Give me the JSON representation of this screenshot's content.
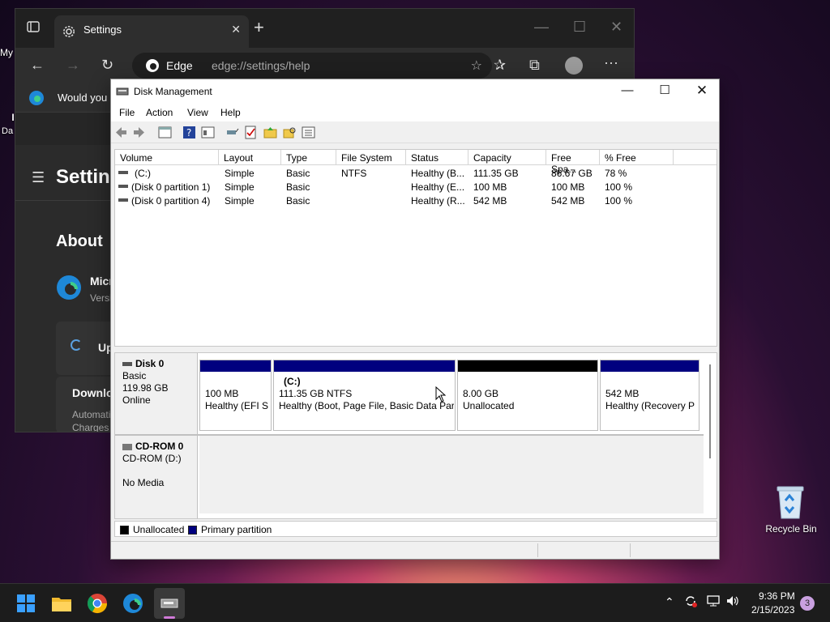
{
  "desktop": {
    "partial_labels": [
      "My",
      "I",
      "Da"
    ],
    "recycle_bin_label": "Recycle Bin"
  },
  "edge": {
    "tab_title": "Settings",
    "site_label": "Edge",
    "url": "edge://settings/help",
    "banner_text": "Would you",
    "page_heading": "Setting",
    "about_heading": "About",
    "product_name": "Micr",
    "version_prefix": "Versi",
    "update_text": "Up",
    "download_text": "Downlo",
    "auto_text": "Automati",
    "charges_text": "Charges"
  },
  "dm": {
    "title": "Disk Management",
    "menu": [
      "File",
      "Action",
      "View",
      "Help"
    ],
    "columns": [
      "Volume",
      "Layout",
      "Type",
      "File System",
      "Status",
      "Capacity",
      "Free Spa...",
      "% Free"
    ],
    "volumes": [
      {
        "volume": "(C:)",
        "layout": "Simple",
        "type": "Basic",
        "fs": "NTFS",
        "status": "Healthy (B...",
        "capacity": "111.35 GB",
        "free": "86.67 GB",
        "pct": "78 %"
      },
      {
        "volume": "(Disk 0 partition 1)",
        "layout": "Simple",
        "type": "Basic",
        "fs": "",
        "status": "Healthy (E...",
        "capacity": "100 MB",
        "free": "100 MB",
        "pct": "100 %"
      },
      {
        "volume": "(Disk 0 partition 4)",
        "layout": "Simple",
        "type": "Basic",
        "fs": "",
        "status": "Healthy (R...",
        "capacity": "542 MB",
        "free": "542 MB",
        "pct": "100 %"
      }
    ],
    "disk0": {
      "name": "Disk 0",
      "type": "Basic",
      "size": "119.98 GB",
      "state": "Online",
      "partitions": [
        {
          "title": "",
          "size": "100 MB",
          "status": "Healthy (EFI Sy",
          "kind": "primary"
        },
        {
          "title": "(C:)",
          "size": "111.35 GB NTFS",
          "status": "Healthy (Boot, Page File, Basic Data Part",
          "kind": "primary"
        },
        {
          "title": "",
          "size": "8.00 GB",
          "status": "Unallocated",
          "kind": "unallocated"
        },
        {
          "title": "",
          "size": "542 MB",
          "status": "Healthy (Recovery Pa",
          "kind": "primary"
        }
      ]
    },
    "cdrom": {
      "name": "CD-ROM 0",
      "drive": "CD-ROM (D:)",
      "media": "No Media"
    },
    "legend": {
      "unallocated": "Unallocated",
      "primary": "Primary partition"
    },
    "colors": {
      "primary": "#00007f",
      "unallocated": "#000000"
    }
  },
  "taskbar": {
    "time": "9:36 PM",
    "date": "2/15/2023",
    "notification_count": "3"
  }
}
